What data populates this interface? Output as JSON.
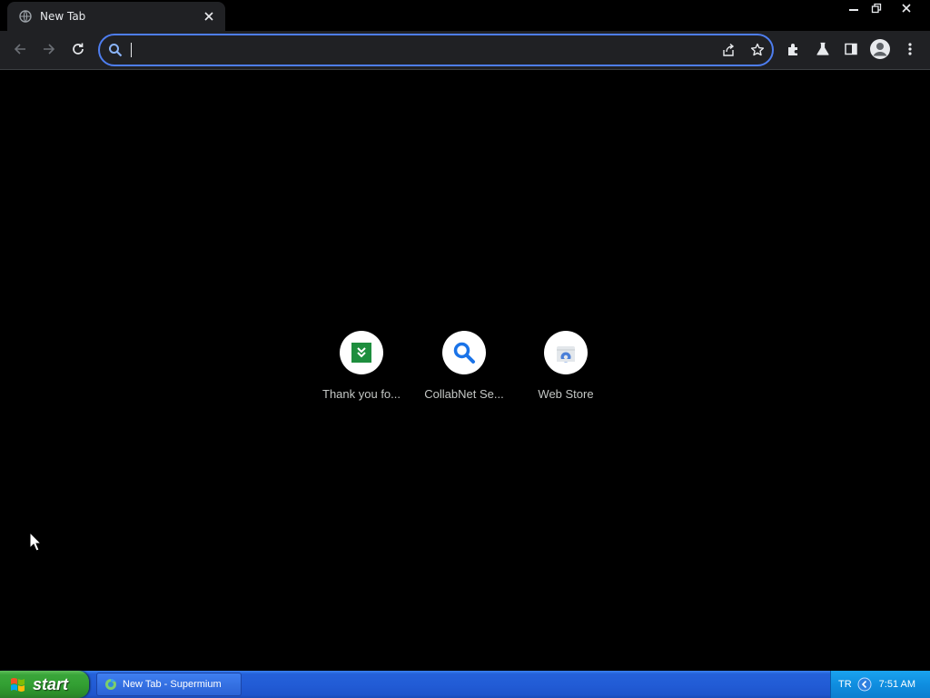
{
  "browser": {
    "tab": {
      "title": "New Tab",
      "favicon": "globe-icon"
    },
    "window_controls": {
      "minimize": "minimize-icon",
      "restore": "restore-icon",
      "close": "close-icon"
    },
    "toolbar": {
      "back": "back-arrow-icon",
      "forward": "forward-arrow-icon",
      "reload": "reload-icon",
      "omnibox": {
        "value": "",
        "placeholder": "",
        "icon": "search-icon",
        "share_icon": "share-icon",
        "bookmark_icon": "star-icon"
      },
      "extensions": "puzzle-icon",
      "labs": "flask-icon",
      "side_panel": "side-panel-icon",
      "profile": "avatar-icon",
      "menu": "kebab-menu-icon"
    }
  },
  "new_tab": {
    "shortcuts": [
      {
        "label": "Thank you fo...",
        "icon": "green-download-icon"
      },
      {
        "label": "CollabNet Se...",
        "icon": "blue-search-icon"
      },
      {
        "label": "Web Store",
        "icon": "web-store-icon"
      }
    ]
  },
  "taskbar": {
    "start_label": "start",
    "task_item": {
      "label": "New Tab - Supermium",
      "icon": "browser-icon"
    },
    "tray": {
      "language": "TR",
      "clock": "7:51 AM"
    }
  },
  "colors": {
    "omnibox_border": "#4e7ef0",
    "toolbar_bg": "#202124",
    "taskbar_blue": "#225cd6",
    "start_green": "#33a033"
  }
}
